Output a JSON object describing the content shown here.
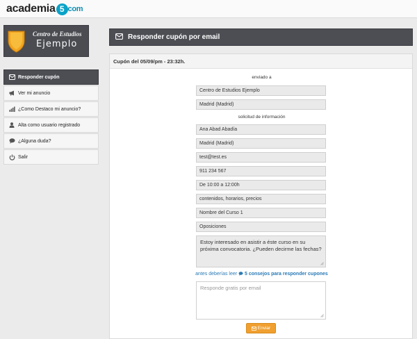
{
  "app": {
    "logo_prefix": "academia",
    "logo_five": "5",
    "logo_suffix": "com"
  },
  "brand": {
    "line1": "Centro de Estudios",
    "line2": "Ejemplo"
  },
  "sidebar": {
    "items": [
      {
        "label": "Responder cupón",
        "icon": "envelope-icon"
      },
      {
        "label": "Ver mi anuncio",
        "icon": "megaphone-icon"
      },
      {
        "label": "¿Como Destaco mi anuncio?",
        "icon": "bar-chart-icon"
      },
      {
        "label": "Alta como usuario registrado",
        "icon": "user-icon"
      },
      {
        "label": "¿Alguna duda?",
        "icon": "chat-bubble-icon"
      },
      {
        "label": "Salir",
        "icon": "power-icon"
      }
    ]
  },
  "header": {
    "title": "Responder cupón por email"
  },
  "coupon": {
    "heading": "Cupón del 05/09/pm - 23:32h.",
    "sent_to_label": "enviado a",
    "center_name": "Centro de Estudios Ejemplo",
    "center_location": "Madrid (Madrid)",
    "request_label": "solicitud de información",
    "name": "Ana Abad Abadía",
    "location": "Madrid (Madrid)",
    "email": "test@test.es",
    "phone": "911 234 567",
    "schedule": "De 10:00 a 12:00h",
    "interest": "contenidos, horarios, precios",
    "course": "Nombre del Curso 1",
    "category": "Oposiciones",
    "message": "Estoy interesado en asistir a éste curso en su próxima convocatoria. ¿Pueden decirme las fechas?",
    "tip_prefix": "antes deberías leer",
    "tip_link": "5 consejos para responder cupones",
    "reply_placeholder": "Responde gratis por email",
    "send_label": "Enviar"
  },
  "colors": {
    "accent": "#f0a030",
    "dark_bar": "#4d4e54",
    "link": "#2a7ab5",
    "logo_circle": "#0aa3c8"
  }
}
